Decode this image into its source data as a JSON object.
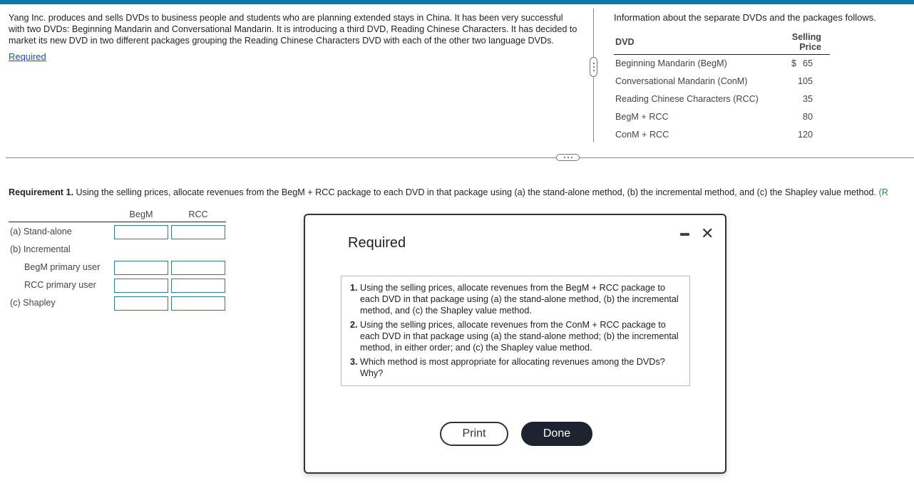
{
  "colors": {
    "topbar": "#0e7a99",
    "link": "#1a4fb5",
    "more_link": "#2e8b3c",
    "input_border": "#2b7f8e",
    "done_button": "#1d2430"
  },
  "intro": {
    "paragraph": "Yang Inc. produces and sells DVDs to business people and students who are planning extended stays in China. It has been very successful with two DVDs: Beginning Mandarin and Conversational Mandarin. It is introducing a third DVD, Reading Chinese Characters. It has decided to market its new DVD in two different packages grouping the Reading Chinese Characters DVD with each of the other two language DVDs.",
    "required_link": "Required"
  },
  "info": {
    "lead": "Information about the separate DVDs and the packages follows.",
    "table": {
      "headers": [
        "DVD",
        "Selling Price"
      ],
      "rows": [
        {
          "name": "Beginning Mandarin (BegM)",
          "currency": "$",
          "price": "65"
        },
        {
          "name": "Conversational Mandarin (ConM)",
          "currency": "",
          "price": "105"
        },
        {
          "name": "Reading Chinese Characters (RCC)",
          "currency": "",
          "price": "35"
        },
        {
          "name": "BegM + RCC",
          "currency": "",
          "price": "80"
        },
        {
          "name": "ConM + RCC",
          "currency": "",
          "price": "120"
        }
      ]
    }
  },
  "requirement1": {
    "label": "Requirement 1.",
    "text": " Using the selling prices, allocate revenues from the BegM + RCC package to each DVD in that package using (a) the stand-alone method, (b) the incremental method, and (c) the Shapley value method. ",
    "more": "(R"
  },
  "grid": {
    "columns": [
      "BegM",
      "RCC"
    ],
    "rows": [
      {
        "label": "(a) Stand-alone",
        "inputs": true,
        "values": [
          "",
          ""
        ]
      },
      {
        "label": "(b) Incremental",
        "inputs": false
      },
      {
        "label": "BegM primary user",
        "inputs": true,
        "indent": true,
        "values": [
          "",
          ""
        ]
      },
      {
        "label": "RCC primary user",
        "inputs": true,
        "indent": true,
        "values": [
          "",
          ""
        ]
      },
      {
        "label": "(c) Shapley",
        "inputs": true,
        "values": [
          "",
          ""
        ]
      }
    ]
  },
  "modal": {
    "title": "Required",
    "minimize_icon": "minimize-icon",
    "close_icon": "close-icon",
    "close_glyph": "✕",
    "items": [
      "Using the selling prices, allocate revenues from the BegM + RCC package to each DVD in that package using (a) the stand-alone method, (b) the incremental method, and (c) the Shapley value method.",
      "Using the selling prices, allocate revenues from the ConM + RCC package to each DVD in that package using (a) the stand-alone method; (b) the incremental method, in either order; and (c) the Shapley value method.",
      "Which method is most appropriate for allocating revenues among the DVDs? Why?"
    ],
    "print_label": "Print",
    "done_label": "Done"
  }
}
